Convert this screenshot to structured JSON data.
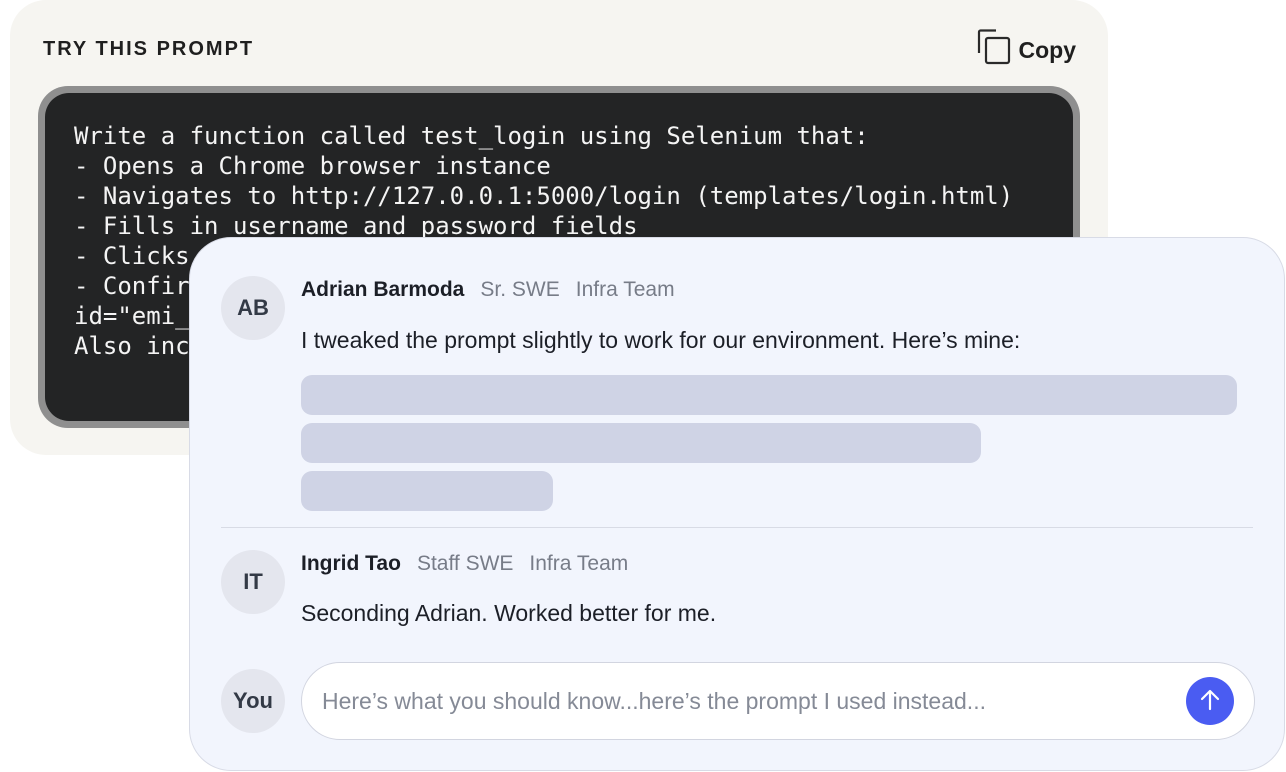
{
  "prompt_card": {
    "heading": "TRY THIS PROMPT",
    "copy_label": "Copy",
    "copy_icon": "copy-icon",
    "code_lines": [
      "Write a function called test_login using Selenium that:",
      "- Opens a Chrome browser instance",
      "- Navigates to http://127.0.0.1:5000/login (templates/login.html)",
      "- Fills in username and password fields",
      "- Clicks",
      "- Confir",
      "id=\"emi_",
      "",
      "Also inc"
    ]
  },
  "comments": [
    {
      "initials": "AB",
      "name": "Adrian Barmoda",
      "title": "Sr. SWE",
      "team": "Infra Team",
      "text": "I tweaked the prompt slightly to work for our environment. Here’s mine:"
    },
    {
      "initials": "IT",
      "name": "Ingrid Tao",
      "title": "Staff SWE",
      "team": "Infra Team",
      "text": "Seconding Adrian. Worked better for me."
    }
  ],
  "reply": {
    "avatar_label": "You",
    "placeholder": "Here’s what you should know...here’s the prompt I used instead...",
    "send_icon": "arrow-up-icon"
  },
  "colors": {
    "card_bg": "#f6f5f1",
    "code_bg": "#232425",
    "panel_bg": "#f2f5fd",
    "skeleton": "#cfd3e5",
    "send_button": "#4a5cf2"
  }
}
